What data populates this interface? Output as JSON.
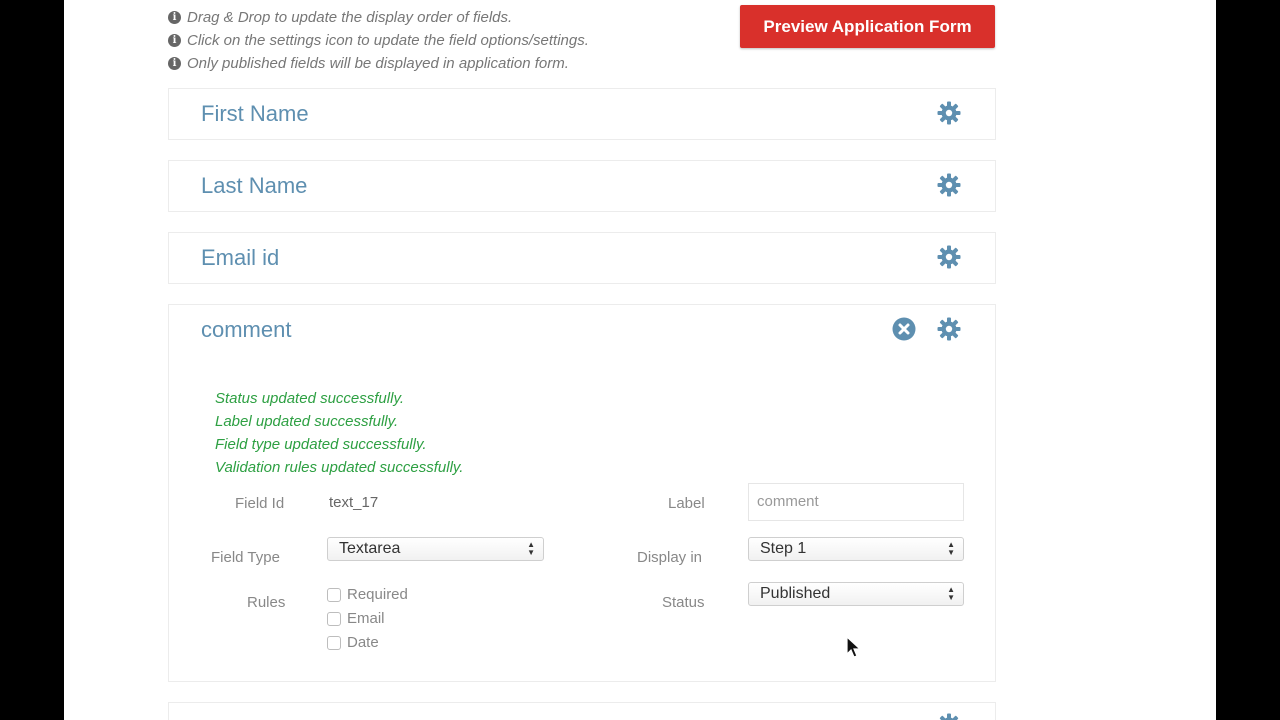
{
  "instructions": [
    "Drag & Drop to update the display order of fields.",
    "Click on the settings icon to update the field options/settings.",
    "Only published fields will be displayed in application form."
  ],
  "preview_button_label": "Preview Application Form",
  "fields": [
    {
      "title": "First Name"
    },
    {
      "title": "Last Name"
    },
    {
      "title": "Email id"
    },
    {
      "title": "comment"
    }
  ],
  "expanded": {
    "messages": [
      "Status updated successfully.",
      "Label updated successfully.",
      "Field type updated successfully.",
      "Validation rules updated successfully."
    ],
    "field_id_label": "Field Id",
    "field_id_value": "text_17",
    "label_label": "Label",
    "label_placeholder": "comment",
    "field_type_label": "Field Type",
    "field_type_value": "Textarea",
    "display_in_label": "Display in",
    "display_in_value": "Step 1",
    "rules_label": "Rules",
    "rules": [
      "Required",
      "Email",
      "Date"
    ],
    "status_label": "Status",
    "status_value": "Published"
  },
  "colors": {
    "accent_blue": "#5e8fb0",
    "button_red": "#d9302b",
    "success_green": "#2ea043"
  },
  "icons": {
    "info": "info-circle-icon",
    "gear": "gear-icon",
    "close": "close-circle-icon"
  }
}
